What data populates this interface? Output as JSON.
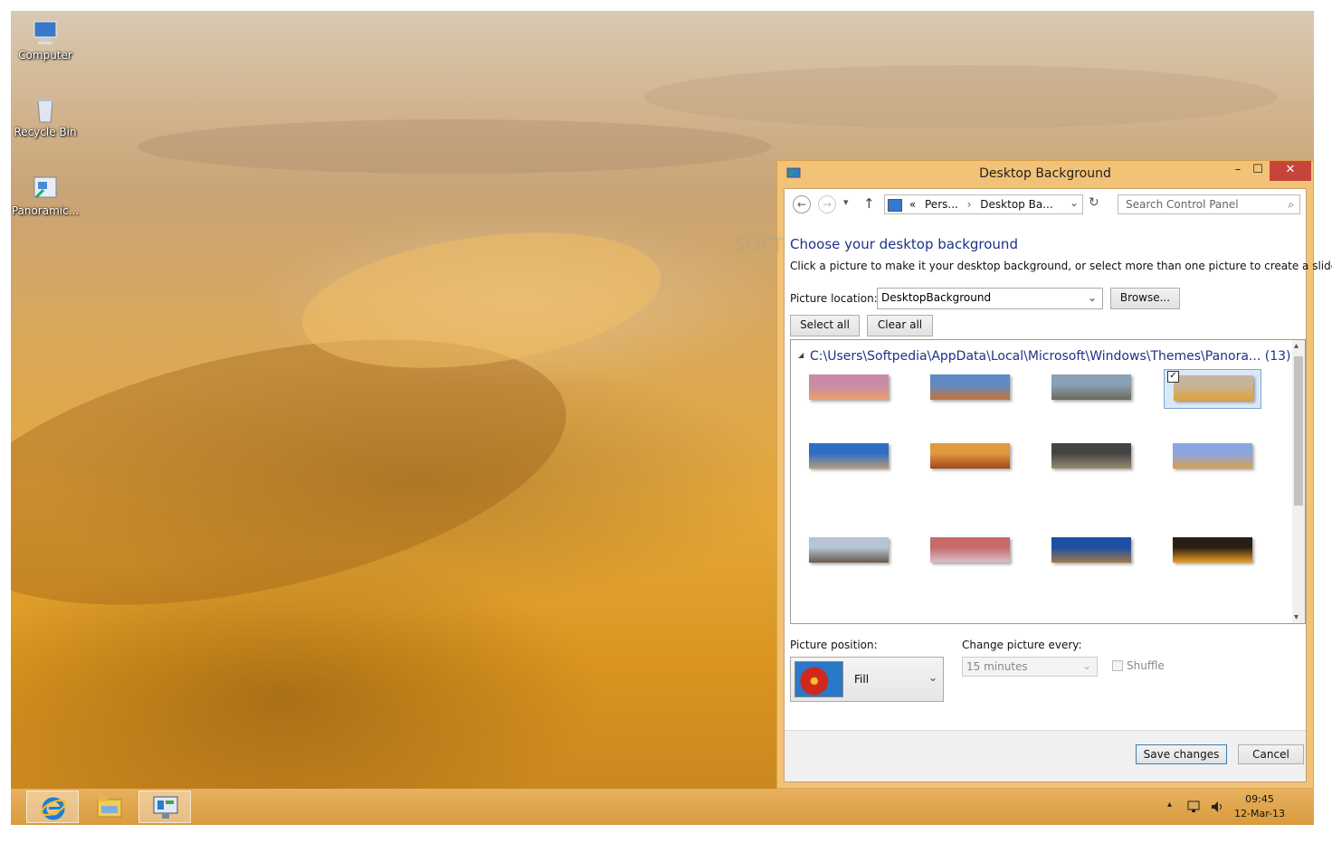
{
  "desktop": {
    "icons": [
      {
        "label": "Computer",
        "icon": "computer-icon"
      },
      {
        "label": "Recycle Bin",
        "icon": "recycle-bin-icon"
      },
      {
        "label": "Panoramic...",
        "icon": "control-panel-shortcut-icon"
      }
    ]
  },
  "window": {
    "title": "Desktop Background",
    "controls": {
      "minimize": "–",
      "maximize": "☐",
      "close": "✕"
    },
    "nav": {
      "back": "←",
      "forward": "→",
      "history": "▾",
      "up": "↑",
      "breadcrumb_prefix": "«",
      "crumb1": "Pers...",
      "crumb_sep": "›",
      "crumb2": "Desktop Ba...",
      "dropdown": "⌄",
      "refresh": "↻",
      "search_placeholder": "Search Control Panel",
      "search_icon": "⌕"
    },
    "heading": "Choose your desktop background",
    "subtitle": "Click a picture to make it your desktop background, or select more than one picture to create a slide show.",
    "picture_location_label": "Picture location:",
    "picture_location_value": "DesktopBackground",
    "browse_label": "Browse...",
    "select_all_label": "Select all",
    "clear_all_label": "Clear all",
    "group_toggle": "◢",
    "group_label": "C:\\Users\\Softpedia\\AppData\\Local\\Microsoft\\Windows\\Themes\\Panora... (13)",
    "thumbnails": [
      {
        "name": "thumb-purple-desert",
        "checked": false,
        "colors": [
          "#c98aa8",
          "#e8a06a"
        ]
      },
      {
        "name": "thumb-rock-formations",
        "checked": false,
        "colors": [
          "#5e8ac4",
          "#c5743a"
        ]
      },
      {
        "name": "thumb-rocky-beach",
        "checked": false,
        "colors": [
          "#8aa0b4",
          "#6b6a5c"
        ]
      },
      {
        "name": "thumb-sand-dunes",
        "checked": true,
        "colors": [
          "#c7b49a",
          "#e0a236"
        ]
      },
      {
        "name": "thumb-arch-rock",
        "checked": false,
        "colors": [
          "#2e6fc4",
          "#b89a7a"
        ]
      },
      {
        "name": "thumb-red-canyon",
        "checked": false,
        "colors": [
          "#e09a40",
          "#a34618"
        ]
      },
      {
        "name": "thumb-storm-canyon",
        "checked": false,
        "colors": [
          "#444",
          "#9a8a70"
        ]
      },
      {
        "name": "thumb-pinnacles",
        "checked": false,
        "colors": [
          "#8aa6e0",
          "#d9a050"
        ]
      },
      {
        "name": "thumb-boulders",
        "checked": false,
        "colors": [
          "#b6c4d4",
          "#6a5a48"
        ]
      },
      {
        "name": "thumb-salt-flats",
        "checked": false,
        "colors": [
          "#c86a6a",
          "#d8c0c8"
        ]
      },
      {
        "name": "thumb-desert-blue-sky",
        "checked": false,
        "colors": [
          "#1e4fa0",
          "#a07a48"
        ]
      },
      {
        "name": "thumb-sunset",
        "checked": false,
        "colors": [
          "#2a1e14",
          "#f0a020"
        ]
      }
    ],
    "picture_position_label": "Picture position:",
    "picture_position_value": "Fill",
    "change_every_label": "Change picture every:",
    "change_every_value": "15 minutes",
    "shuffle_label": "Shuffle",
    "save_label": "Save changes",
    "cancel_label": "Cancel"
  },
  "taskbar": {
    "apps": [
      {
        "name": "internet-explorer-icon"
      },
      {
        "name": "file-explorer-icon"
      },
      {
        "name": "control-panel-icon"
      }
    ],
    "tray": {
      "chevron": "▴"
    },
    "time": "09:45",
    "date": "12-Mar-13"
  },
  "watermark": "SOFT"
}
